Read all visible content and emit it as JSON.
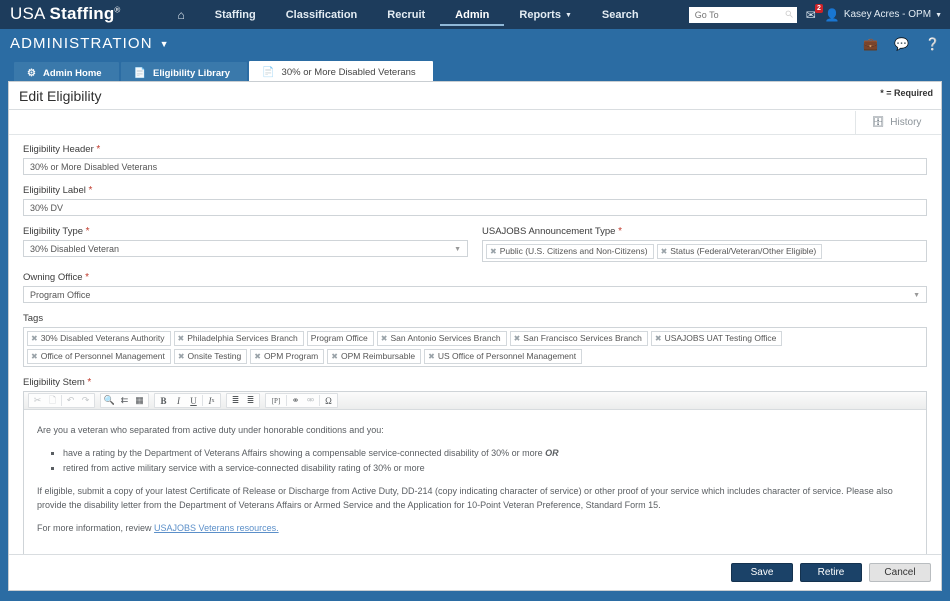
{
  "brand": {
    "prefix": "USA ",
    "name": "Staffing",
    "reg": "®"
  },
  "topnav": {
    "home_icon": "home-icon",
    "items": [
      {
        "label": "Staffing",
        "active": false,
        "caret": false
      },
      {
        "label": "Classification",
        "active": false,
        "caret": false
      },
      {
        "label": "Recruit",
        "active": false,
        "caret": false
      },
      {
        "label": "Admin",
        "active": true,
        "caret": false
      },
      {
        "label": "Reports",
        "active": false,
        "caret": true
      },
      {
        "label": "Search",
        "active": false,
        "caret": false
      }
    ]
  },
  "search": {
    "placeholder": "Go To",
    "icon": "search-icon"
  },
  "messages": {
    "icon": "envelope-icon",
    "count": "2"
  },
  "account": {
    "icon": "user-icon",
    "name": "Kasey Acres - OPM",
    "caret": "chevron-down-icon"
  },
  "subheader": {
    "title": "ADMINISTRATION",
    "caret": "chevron-down-icon",
    "icons": [
      "briefcase-icon",
      "chat-icon",
      "help-icon"
    ]
  },
  "tabs": [
    {
      "label": "Admin Home",
      "icon": "gear-icon",
      "active": false
    },
    {
      "label": "Eligibility Library",
      "icon": "document-icon",
      "active": false
    },
    {
      "label": "30% or More Disabled Veterans",
      "icon": "document-icon",
      "active": true
    }
  ],
  "card": {
    "title": "Edit Eligibility",
    "required_note": "* = Required",
    "history_label": "History",
    "history_icon": "history-icon"
  },
  "form": {
    "eligibility_header": {
      "label": "Eligibility Header",
      "required": "*",
      "value": "30% or More Disabled Veterans"
    },
    "eligibility_label": {
      "label": "Eligibility Label",
      "required": "*",
      "value": "30% DV"
    },
    "eligibility_type": {
      "label": "Eligibility Type",
      "required": "*",
      "value": "30% Disabled Veteran"
    },
    "usajobs_announcement_type": {
      "label": "USAJOBS Announcement Type",
      "required": "*",
      "tokens": [
        "Public (U.S. Citizens and Non-Citizens)",
        "Status (Federal/Veteran/Other Eligible)"
      ]
    },
    "owning_office": {
      "label": "Owning Office",
      "required": "*",
      "value": "Program Office"
    },
    "tags": {
      "label": "Tags",
      "tokens": [
        {
          "label": "30% Disabled Veterans Authority",
          "removable": true
        },
        {
          "label": "Philadelphia Services Branch",
          "removable": true
        },
        {
          "label": "Program Office",
          "removable": false
        },
        {
          "label": "San Antonio Services Branch",
          "removable": true
        },
        {
          "label": "San Francisco Services Branch",
          "removable": true
        },
        {
          "label": "USAJOBS UAT Testing Office",
          "removable": true
        },
        {
          "label": "Office of Personnel Management",
          "removable": true
        },
        {
          "label": "Onsite Testing",
          "removable": true
        },
        {
          "label": "OPM Program",
          "removable": true
        },
        {
          "label": "OPM Reimbursable",
          "removable": true
        },
        {
          "label": "US Office of Personnel Management",
          "removable": true
        }
      ]
    },
    "eligibility_stem": {
      "label": "Eligibility Stem",
      "required": "*",
      "toolbar": [
        {
          "glyph": "✂",
          "name": "cut-icon",
          "dim": true
        },
        {
          "glyph": "❐",
          "name": "copy-icon",
          "dim": true
        },
        {
          "sep": true
        },
        {
          "glyph": "↶",
          "name": "undo-icon",
          "dim": true
        },
        {
          "glyph": "↷",
          "name": "redo-icon",
          "dim": true
        },
        {
          "group": true
        },
        {
          "glyph": "🔍",
          "name": "find-icon",
          "dim": false
        },
        {
          "glyph": "⎇",
          "name": "replace-icon",
          "dim": false
        },
        {
          "glyph": "▣",
          "name": "select-all-icon",
          "dim": false
        },
        {
          "group": true
        },
        {
          "glyph": "B",
          "name": "bold-icon",
          "dim": false
        },
        {
          "glyph": "I",
          "name": "italic-icon",
          "dim": false
        },
        {
          "glyph": "U",
          "name": "underline-icon",
          "dim": false
        },
        {
          "sep": true
        },
        {
          "glyph": "Iₓ",
          "name": "remove-format-icon",
          "dim": false
        },
        {
          "group": true
        },
        {
          "glyph": "≡",
          "name": "numbered-list-icon",
          "dim": false
        },
        {
          "glyph": "≣",
          "name": "bulleted-list-icon",
          "dim": false
        },
        {
          "group": true
        },
        {
          "glyph": "[P]",
          "name": "paste-plain-text-icon",
          "dim": false
        },
        {
          "sep": true
        },
        {
          "glyph": "⚭",
          "name": "link-icon",
          "dim": false
        },
        {
          "glyph": "⚮",
          "name": "unlink-icon",
          "dim": true
        },
        {
          "sep": true
        },
        {
          "glyph": "Ω",
          "name": "special-character-icon",
          "dim": false
        }
      ],
      "content": {
        "intro": "Are you a veteran who separated from active duty under honorable conditions and you:",
        "bullets": [
          {
            "text": "have a rating by the Department of Veterans Affairs showing a compensable service-connected disability of 30% or more ",
            "emphasis": "OR"
          },
          {
            "text": "retired from active military service with a service-connected disability rating of 30% or more",
            "emphasis": ""
          }
        ],
        "paragraph": "If eligible, submit a copy of your latest Certificate of Release or Discharge from Active Duty, DD-214 (copy indicating character of service) or other proof of your service which includes character of service. Please also provide the disability letter from the Department of Veterans Affairs or Armed Service and the Application for 10-Point Veteran Preference, Standard Form 15.",
        "footer_prefix": "For more information, review ",
        "footer_link": "USAJOBS Veterans resources."
      }
    }
  },
  "footer": {
    "save": "Save",
    "retire": "Retire",
    "cancel": "Cancel"
  },
  "colors": {
    "topbar": "#1d3c5c",
    "subbar": "#2b6ca3",
    "tab_inactive": "#3a79ab",
    "primary_button": "#1b4268",
    "badge_red": "#cc2229",
    "required_star": "#c0392b",
    "link": "#5b8fc9"
  }
}
